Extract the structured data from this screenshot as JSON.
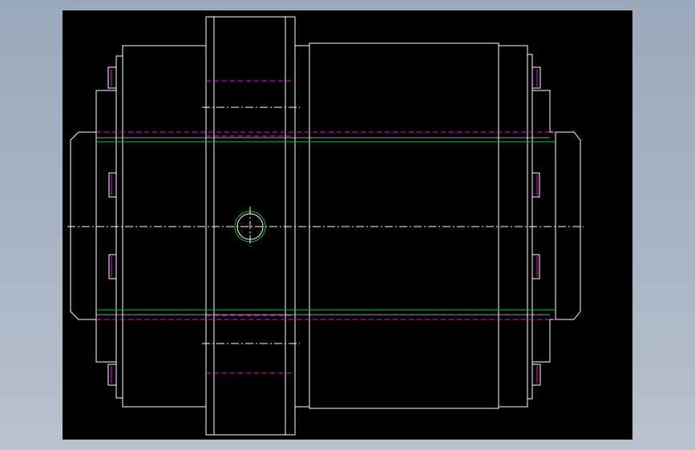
{
  "drawing": {
    "background": "#000000",
    "colors": {
      "outline": "#ffffff",
      "hidden_line": "#ff00ff",
      "centerline": "#ffffff",
      "construction": "#00cc33"
    },
    "linetypes": {
      "outline": "continuous",
      "hidden_line": "dashed",
      "centerline": "dash-dot"
    }
  }
}
